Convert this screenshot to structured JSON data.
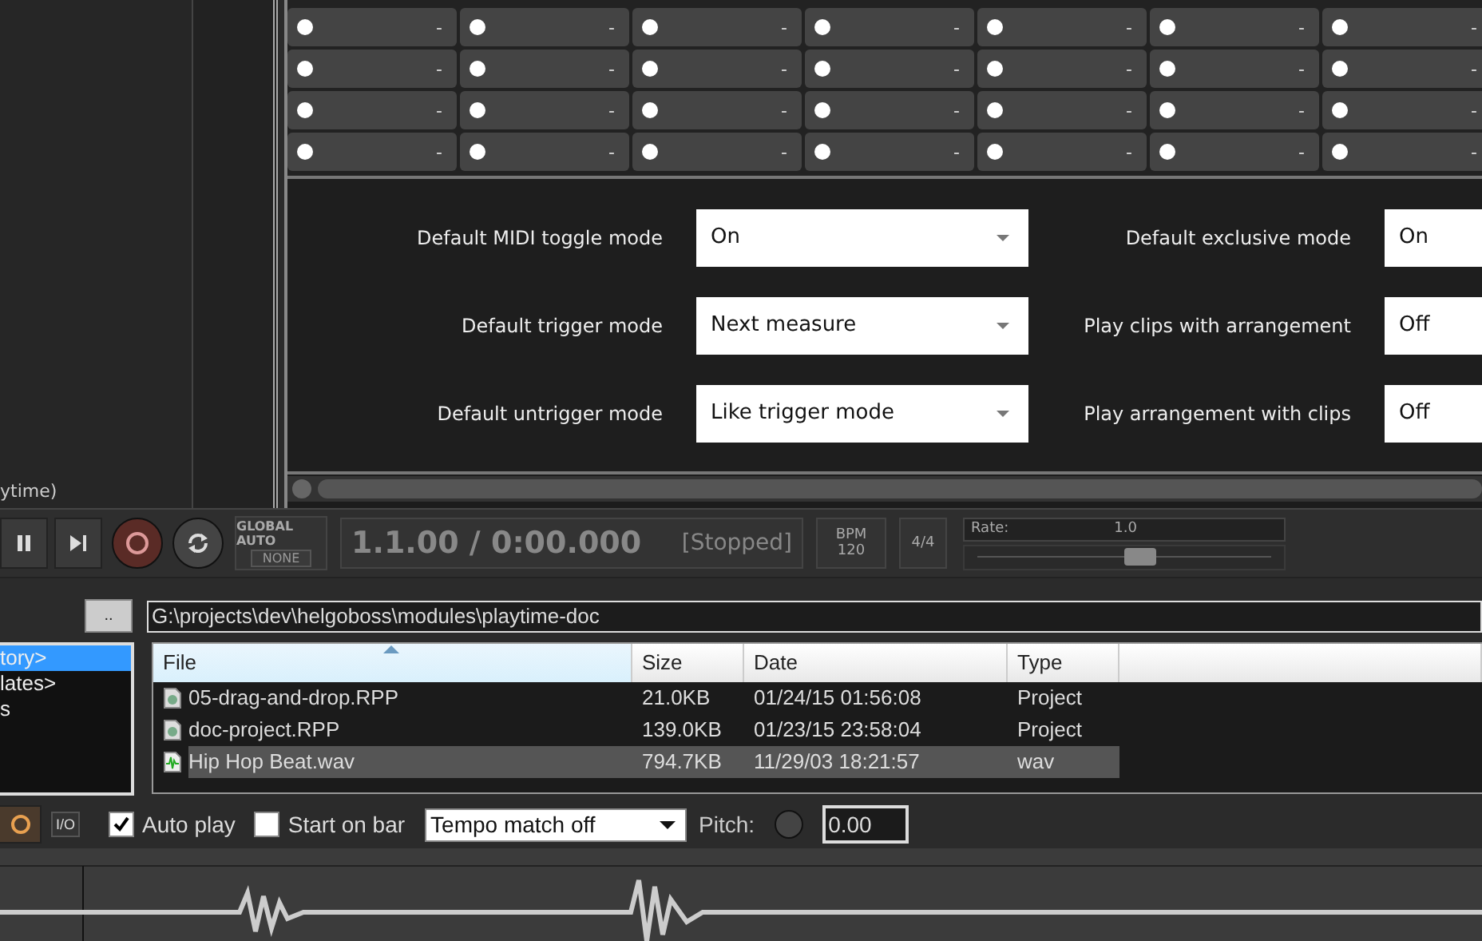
{
  "left_panel": {
    "caption": "ytime)"
  },
  "clip_grid": {
    "rows": [
      [
        "-",
        "-",
        "-",
        "-",
        "-",
        "-",
        "-"
      ],
      [
        "-",
        "-",
        "-",
        "-",
        "-",
        "-",
        "-"
      ],
      [
        "-",
        "-",
        "-",
        "-",
        "-",
        "-",
        "-"
      ],
      [
        "-",
        "-",
        "-",
        "-",
        "-",
        "-",
        "-"
      ]
    ]
  },
  "settings": [
    {
      "label": "Default MIDI toggle mode",
      "value": "On"
    },
    {
      "label": "Default exclusive mode",
      "value": "On"
    },
    {
      "label": "Default trigger mode",
      "value": "Next measure"
    },
    {
      "label": "Play clips with arrangement",
      "value": "Off"
    },
    {
      "label": "Default untrigger mode",
      "value": "Like trigger mode"
    },
    {
      "label": "Play arrangement with clips",
      "value": "Off"
    }
  ],
  "transport": {
    "global_auto": {
      "label": "GLOBAL AUTO",
      "mode": "NONE"
    },
    "time": "1.1.00 / 0:00.000",
    "status": "[Stopped]",
    "bpm": {
      "label": "BPM",
      "value": "120"
    },
    "time_signature": "4/4",
    "rate": {
      "label": "Rate:",
      "value": "1.0",
      "level": 0.5
    }
  },
  "browser": {
    "up_button": "..",
    "path": "G:\\projects\\dev\\helgoboss\\modules\\playtime-doc",
    "sidebar": [
      {
        "label": "tory>",
        "selected": true
      },
      {
        "label": "lates>",
        "selected": false
      },
      {
        "label": "s",
        "selected": false
      }
    ],
    "columns": [
      "File",
      "Size",
      "Date",
      "Type"
    ],
    "rows": [
      {
        "kind": "project",
        "file": "05-drag-and-drop.RPP",
        "size": "21.0KB",
        "date": "01/24/15 01:56:08",
        "type": "Project",
        "selected": false
      },
      {
        "kind": "project",
        "file": "doc-project.RPP",
        "size": "139.0KB",
        "date": "01/23/15 23:58:04",
        "type": "Project",
        "selected": false
      },
      {
        "kind": "audio",
        "file": "Hip Hop Beat.wav",
        "size": "794.7KB",
        "date": "11/29/03 18:21:57",
        "type": "wav",
        "selected": true
      }
    ]
  },
  "options": {
    "io_button": "I/O",
    "auto_play": {
      "label": "Auto play",
      "checked": true
    },
    "start_on_bar": {
      "label": "Start on bar",
      "checked": false
    },
    "tempo_match": "Tempo match off",
    "pitch_label": "Pitch:",
    "pitch_value": "0.00"
  }
}
